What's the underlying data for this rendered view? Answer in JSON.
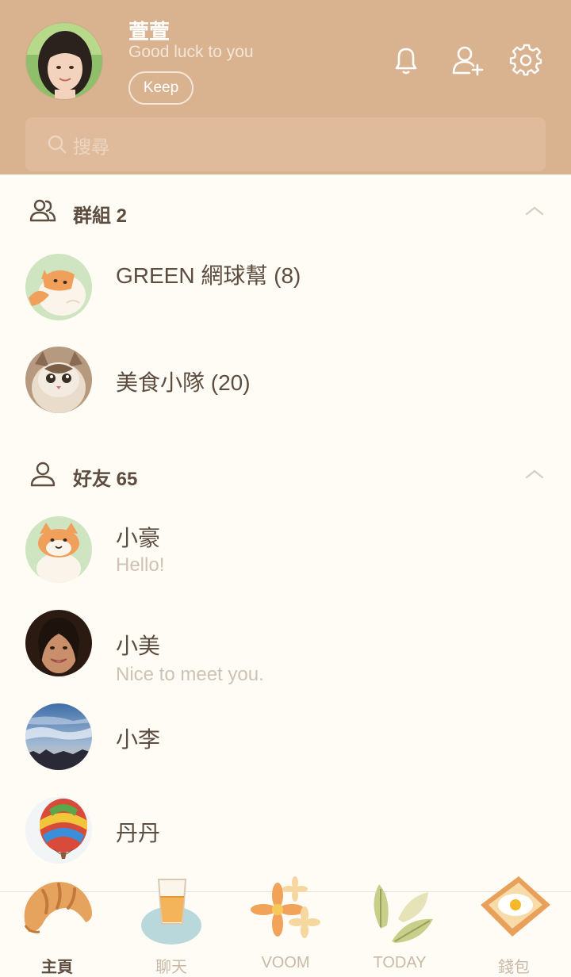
{
  "profile": {
    "name": "萱萱",
    "status": "Good luck to you",
    "keep_label": "Keep"
  },
  "header_icons": [
    "bell-icon",
    "add-friend-icon",
    "settings-gear-icon"
  ],
  "search": {
    "placeholder": "搜尋"
  },
  "groups_section": {
    "title": "群組 2",
    "items": [
      {
        "name": "GREEN 網球幫 (8)"
      },
      {
        "name": "美食小隊 (20)"
      }
    ]
  },
  "friends_section": {
    "title": "好友 65",
    "items": [
      {
        "name": "小豪",
        "status": "Hello!"
      },
      {
        "name": "小美",
        "status": "Nice to meet you."
      },
      {
        "name": "小李",
        "status": ""
      },
      {
        "name": "丹丹",
        "status": ""
      }
    ]
  },
  "bottom_nav": [
    {
      "label": "主頁",
      "active": true
    },
    {
      "label": "聊天",
      "active": false
    },
    {
      "label": "VOOM",
      "active": false
    },
    {
      "label": "TODAY",
      "active": false
    },
    {
      "label": "錢包",
      "active": false
    }
  ],
  "colors": {
    "header_bg": "#d9b290",
    "page_bg": "#fefcf4",
    "text_primary": "#5d4c40",
    "text_muted": "#cfc2b4"
  }
}
